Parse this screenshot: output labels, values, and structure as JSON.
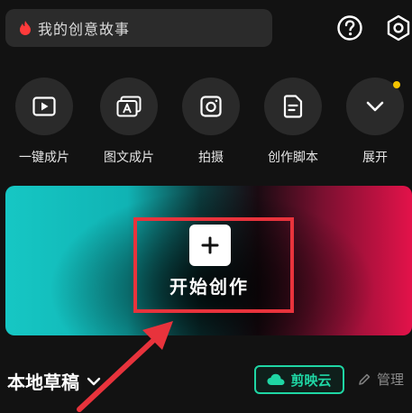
{
  "search": {
    "placeholder": "我的创意故事"
  },
  "actions": [
    {
      "label": "一键成片",
      "icon": "play-icon"
    },
    {
      "label": "图文成片",
      "icon": "text-image-icon"
    },
    {
      "label": "拍摄",
      "icon": "camera-icon"
    },
    {
      "label": "创作脚本",
      "icon": "script-icon"
    },
    {
      "label": "展开",
      "icon": "chevron-down-icon",
      "has_badge": true
    }
  ],
  "create": {
    "label": "开始创作"
  },
  "drafts": {
    "label": "本地草稿"
  },
  "cloud": {
    "label": "剪映云"
  },
  "manage": {
    "label": "管理"
  },
  "colors": {
    "accent": "#1fd6a4",
    "highlight": "#e8333c",
    "badge": "#f5c400"
  }
}
